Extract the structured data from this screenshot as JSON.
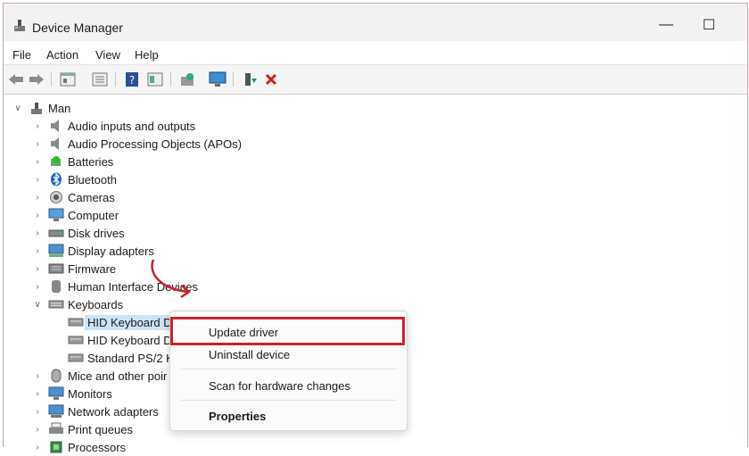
{
  "window": {
    "title": "Device Manager"
  },
  "menu": [
    "File",
    "Action",
    "View",
    "Help"
  ],
  "toolbar_icons": [
    "back-icon",
    "forward-icon",
    "properties-icon",
    "scan-icon",
    "help-icon",
    "action-icon",
    "update-driver-icon",
    "monitor-icon",
    "enable-device-icon",
    "uninstall-icon"
  ],
  "tree": {
    "root": "Man",
    "items": [
      {
        "label": "Audio inputs and outputs",
        "icon": "speaker-icon"
      },
      {
        "label": "Audio Processing Objects (APOs)",
        "icon": "speaker-icon"
      },
      {
        "label": "Batteries",
        "icon": "battery-icon"
      },
      {
        "label": "Bluetooth",
        "icon": "bluetooth-icon"
      },
      {
        "label": "Cameras",
        "icon": "camera-icon"
      },
      {
        "label": "Computer",
        "icon": "computer-icon"
      },
      {
        "label": "Disk drives",
        "icon": "disk-icon"
      },
      {
        "label": "Display adapters",
        "icon": "display-adapter-icon"
      },
      {
        "label": "Firmware",
        "icon": "firmware-icon"
      },
      {
        "label": "Human Interface Devices",
        "icon": "hid-icon"
      },
      {
        "label": "Keyboards",
        "icon": "keyboard-icon"
      }
    ],
    "keyboard_children": [
      "HID Keyboard D",
      "HID Keyboard D",
      "Standard PS/2 K"
    ],
    "after_items": [
      {
        "label": "Mice and other poir",
        "icon": "mouse-icon"
      },
      {
        "label": "Monitors",
        "icon": "monitor-icon"
      },
      {
        "label": "Network adapters",
        "icon": "network-icon"
      },
      {
        "label": "Print queues",
        "icon": "printer-icon"
      },
      {
        "label": "Processors",
        "icon": "cpu-icon"
      }
    ]
  },
  "context_menu": {
    "update": "Update driver",
    "uninstall": "Uninstall device",
    "scan": "Scan for hardware changes",
    "properties": "Properties"
  },
  "colors": {
    "highlight": "#c8242b",
    "selection": "#cce4f7"
  }
}
